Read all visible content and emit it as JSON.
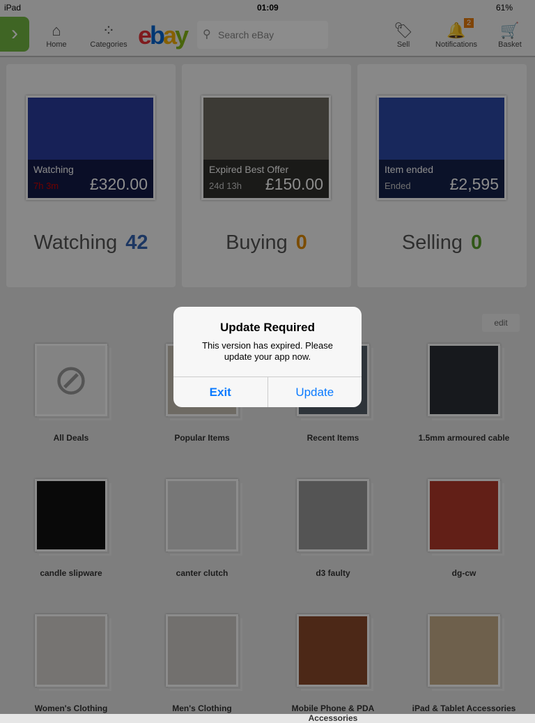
{
  "status": {
    "carrier": "iPad",
    "time": "01:09",
    "battery": "61%"
  },
  "nav": {
    "home": "Home",
    "categories": "Categories",
    "search_placeholder": "Search eBay",
    "sell": "Sell",
    "notifications": "Notifications",
    "notifications_count": "2",
    "basket": "Basket"
  },
  "cards": [
    {
      "title": "Watching",
      "sub": "7h 3m",
      "price": "£320.00",
      "label": "Watching",
      "count": "42",
      "count_color": "#3665b3",
      "photo": "#2a3c9e"
    },
    {
      "title": "Expired Best Offer",
      "sub": "24d 13h",
      "price": "£150.00",
      "label": "Buying",
      "count": "0",
      "count_color": "#e08a00",
      "photo": "#6e6a62"
    },
    {
      "title": "Item ended",
      "sub": "Ended",
      "price": "£2,595",
      "label": "Selling",
      "count": "0",
      "count_color": "#5aa02c",
      "photo": "#2d4aa8"
    }
  ],
  "edit": "edit",
  "tiles": [
    {
      "label": "All Deals",
      "color": "#eeeeee"
    },
    {
      "label": "Popular Items",
      "color": "#c9c2b5"
    },
    {
      "label": "Recent Items",
      "color": "#55606a"
    },
    {
      "label": "1.5mm armoured cable",
      "color": "#2a2f36"
    },
    {
      "label": "candle slipware",
      "color": "#111111"
    },
    {
      "label": "canter clutch",
      "color": "#d9d9d9"
    },
    {
      "label": "d3 faulty",
      "color": "#9a9a9a"
    },
    {
      "label": "dg-cw",
      "color": "#b33a2a"
    },
    {
      "label": "Women's Clothing",
      "color": "#d8d3cf"
    },
    {
      "label": "Men's Clothing",
      "color": "#d0cdc8"
    },
    {
      "label": "Mobile Phone & PDA Accessories",
      "color": "#8a4a2a"
    },
    {
      "label": "iPad & Tablet Accessories",
      "color": "#c8b08a"
    }
  ],
  "alert": {
    "title": "Update Required",
    "message": "This version has expired. Please update your app now.",
    "exit": "Exit",
    "update": "Update"
  }
}
